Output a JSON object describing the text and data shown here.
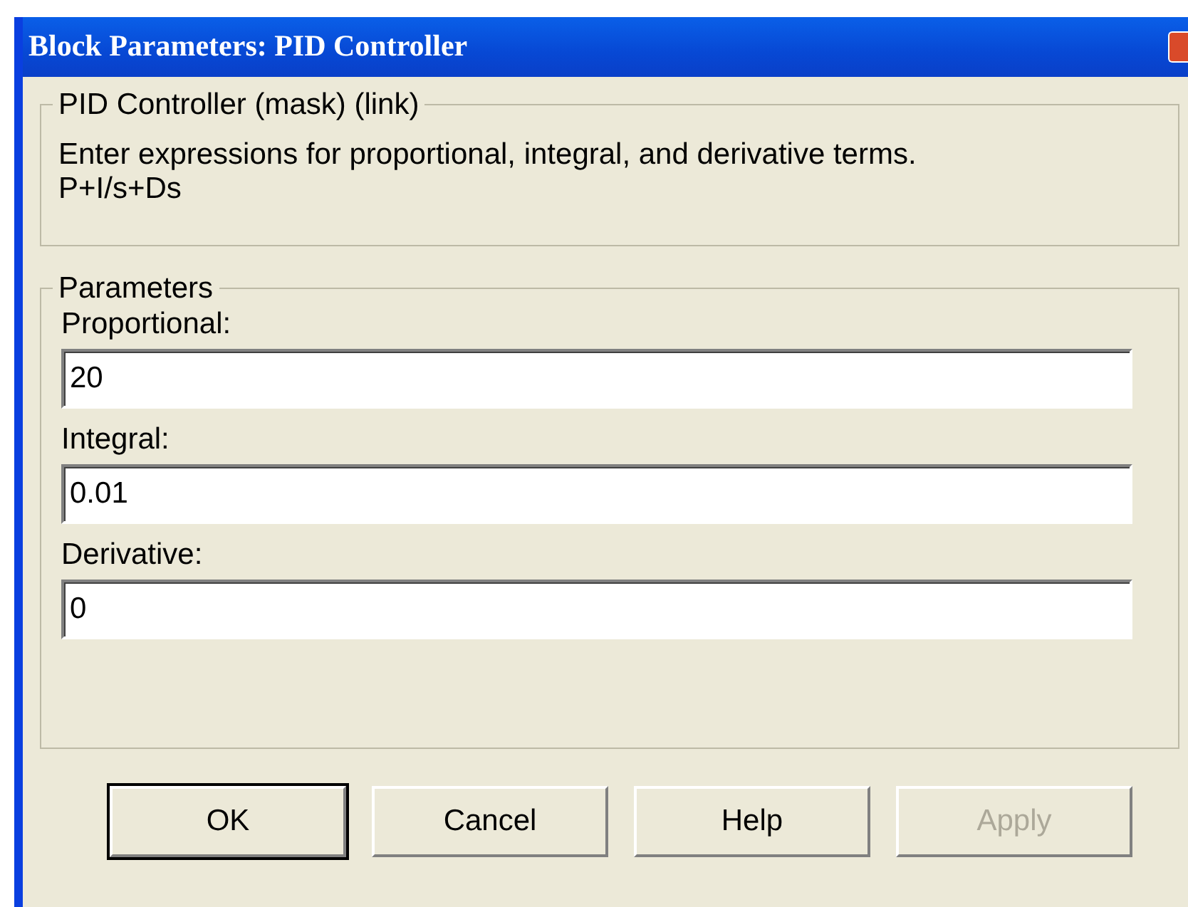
{
  "window": {
    "title": "Block Parameters: PID Controller"
  },
  "mask_group": {
    "legend": "PID Controller (mask) (link)",
    "description": [
      "Enter expressions for proportional, integral, and derivative terms.",
      "P+I/s+Ds"
    ]
  },
  "parameters_group": {
    "legend": "Parameters",
    "fields": [
      {
        "label": "Proportional:",
        "value": "20"
      },
      {
        "label": "Integral:",
        "value": "0.01"
      },
      {
        "label": "Derivative:",
        "value": "0"
      }
    ]
  },
  "buttons": [
    {
      "label": "OK",
      "default": true,
      "disabled": false
    },
    {
      "label": "Cancel",
      "default": false,
      "disabled": false
    },
    {
      "label": "Help",
      "default": false,
      "disabled": false
    },
    {
      "label": "Apply",
      "default": false,
      "disabled": true
    }
  ]
}
